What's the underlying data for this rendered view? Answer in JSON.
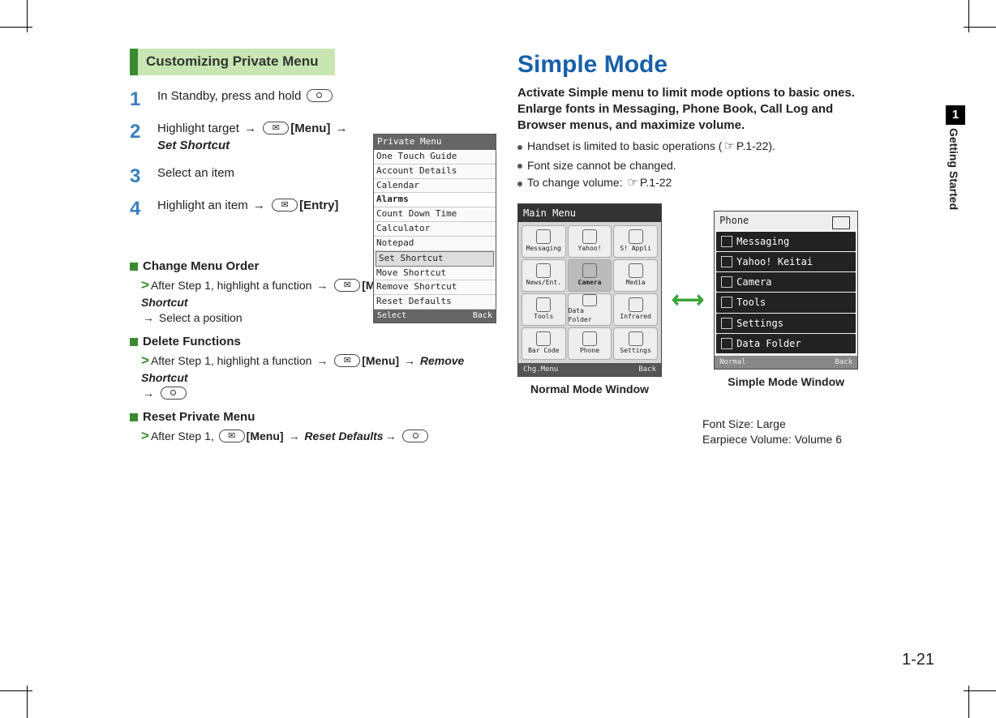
{
  "page": {
    "chapter_num": "1",
    "chapter_title": "Getting Started",
    "page_number": "1-21"
  },
  "left": {
    "section_title": "Customizing Private Menu",
    "steps": [
      {
        "n": "1",
        "text": "In Standby, press and hold "
      },
      {
        "n": "2",
        "pre": "Highlight target ",
        "menu": "[Menu]",
        "post": "Set Shortcut"
      },
      {
        "n": "3",
        "text": "Select an item"
      },
      {
        "n": "4",
        "pre": "Highlight an item ",
        "entry": "[Entry]"
      }
    ],
    "private_menu": {
      "title": "Private Menu",
      "items": [
        "One Touch Guide",
        "Account Details",
        "Calendar",
        "Alarms",
        "Count Down Time",
        "Calculator",
        "Notepad",
        "Set Shortcut",
        "Move Shortcut",
        "Remove Shortcut",
        "Reset Defaults"
      ],
      "highlighted": "Set Shortcut",
      "footer_left": "Select",
      "footer_right": "Back"
    },
    "subs": {
      "h1": "Change Menu Order",
      "l1a": "After Step 1, highlight a function ",
      "l1menu": "[Menu]",
      "l1b": "Move Shortcut",
      "l1c": " Select a position",
      "h2": "Delete Functions",
      "l2a": "After Step 1, highlight a function ",
      "l2menu": "[Menu]",
      "l2b": "Remove Shortcut",
      "h3": "Reset Private Menu",
      "l3a": "After Step 1, ",
      "l3menu": "[Menu]",
      "l3b": "Reset Defaults"
    }
  },
  "right": {
    "heading": "Simple Mode",
    "intro": "Activate Simple menu to limit mode options to basic ones. Enlarge fonts in Messaging, Phone Book, Call Log and Browser menus, and maximize volume.",
    "bullets": [
      {
        "text": "Handset is limited to basic operations (",
        "ref": "P.1-22",
        "tail": ")."
      },
      {
        "text": "Font size cannot be changed."
      },
      {
        "text": "To change volume: ",
        "ref": "P.1-22"
      }
    ],
    "normal": {
      "title": "Main Menu",
      "cells": [
        "Messaging",
        "Yahoo!",
        "S! Appli",
        "News/Ent.",
        "Camera",
        "Media",
        "Tools",
        "Data Folder",
        "Infrared",
        "Bar Code",
        "Phone",
        "Settings"
      ],
      "highlighted": "Camera",
      "footer_left": "Chg.Menu",
      "footer_right": "Back",
      "caption": "Normal Mode Window"
    },
    "simple": {
      "title": "Phone",
      "items": [
        "Messaging",
        "Yahoo! Keitai",
        "Camera",
        "Tools",
        "Settings",
        "Data Folder"
      ],
      "footer_left": "Normal",
      "footer_right": "Back",
      "caption": "Simple Mode Window"
    },
    "notes_line1": "Font Size: Large",
    "notes_line2": "Earpiece Volume: Volume 6"
  }
}
